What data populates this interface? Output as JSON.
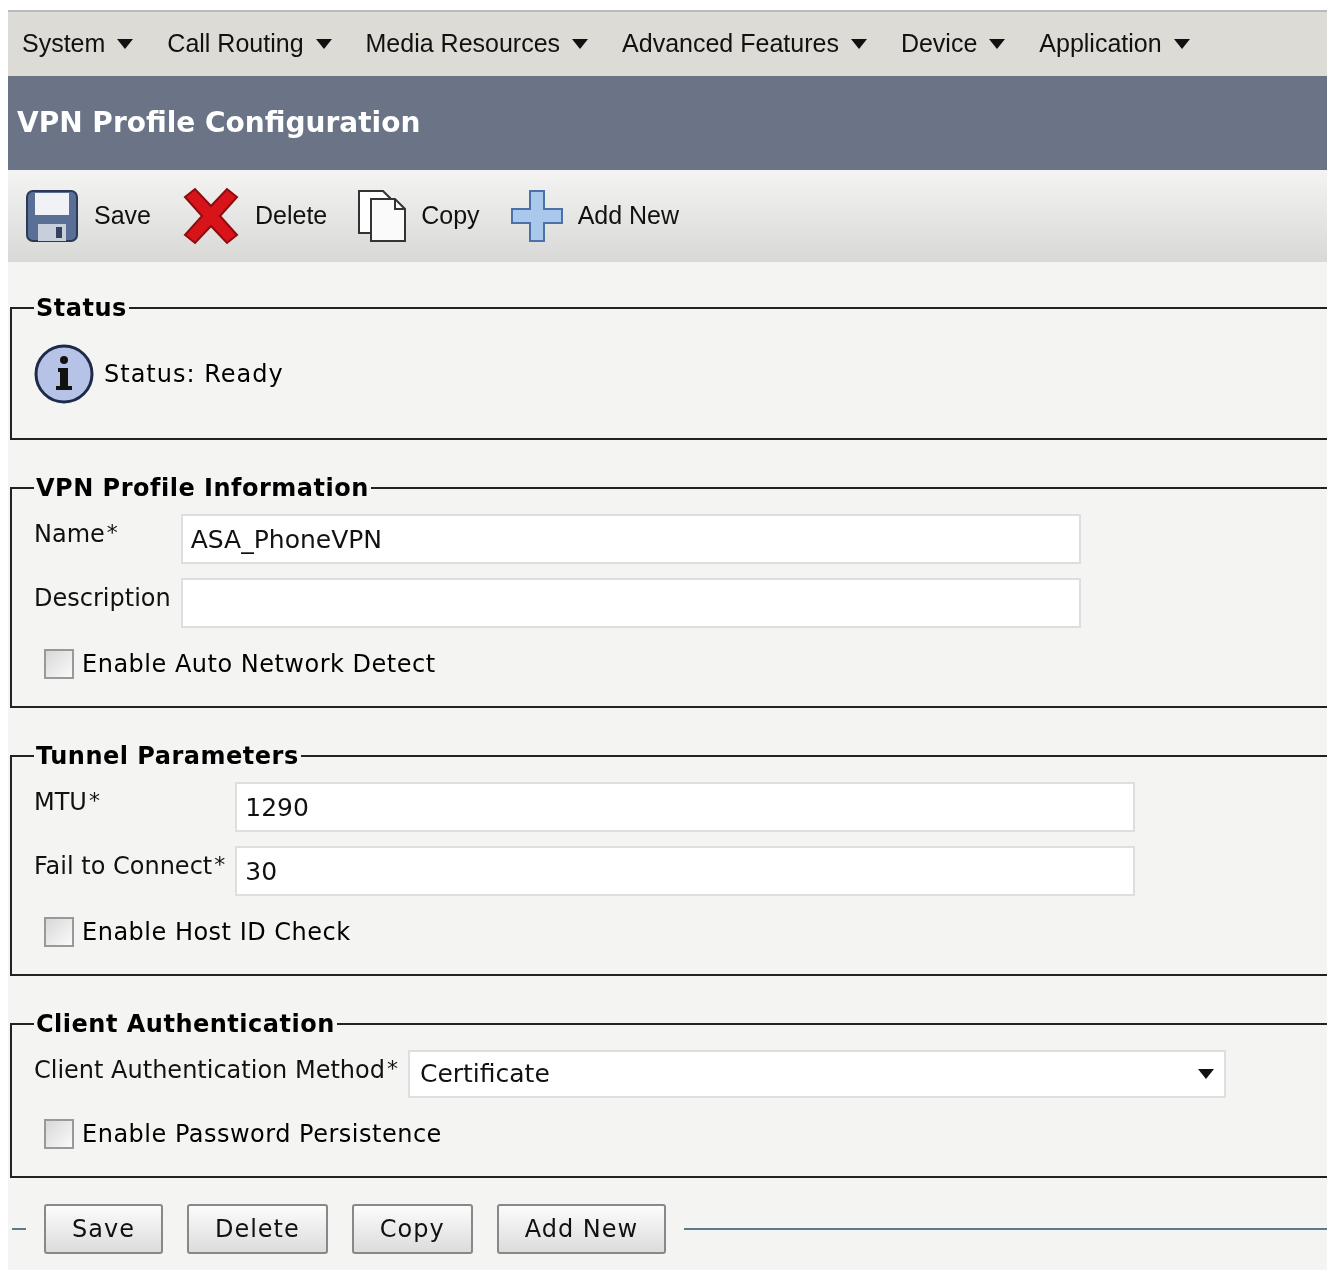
{
  "menu": [
    {
      "label": "System"
    },
    {
      "label": "Call Routing"
    },
    {
      "label": "Media Resources"
    },
    {
      "label": "Advanced Features"
    },
    {
      "label": "Device"
    },
    {
      "label": "Application"
    }
  ],
  "page_title": "VPN Profile Configuration",
  "toolbar": [
    {
      "kind": "save",
      "label": "Save"
    },
    {
      "kind": "delete",
      "label": "Delete"
    },
    {
      "kind": "copy",
      "label": "Copy"
    },
    {
      "kind": "add",
      "label": "Add New"
    }
  ],
  "sections": [
    {
      "title": "Status",
      "rows": [
        {
          "kind": "status",
          "text": "Status: Ready"
        }
      ]
    },
    {
      "title": "VPN Profile Information",
      "rows": [
        {
          "kind": "text",
          "label": "Name",
          "required_mark": "*",
          "value": "ASA_PhoneVPN"
        },
        {
          "kind": "text",
          "label": "Description"
        },
        {
          "kind": "checkbox",
          "label": "Enable Auto Network Detect",
          "checked": false
        }
      ]
    },
    {
      "title": "Tunnel Parameters",
      "rows": [
        {
          "kind": "text",
          "label": "MTU",
          "required_mark": "*",
          "value": "1290"
        },
        {
          "kind": "text",
          "label": "Fail to Connect",
          "required_mark": "*",
          "value": "30"
        },
        {
          "kind": "checkbox",
          "label": "Enable Host ID Check",
          "checked": false
        }
      ]
    },
    {
      "title": "Client Authentication",
      "rows": [
        {
          "kind": "select",
          "label": "Client Authentication Method",
          "required_mark": "*",
          "value": "Certificate"
        },
        {
          "kind": "checkbox",
          "label": "Enable Password Persistence",
          "checked": false
        }
      ]
    }
  ],
  "bottom_buttons": [
    "Save",
    "Delete",
    "Copy",
    "Add New"
  ]
}
